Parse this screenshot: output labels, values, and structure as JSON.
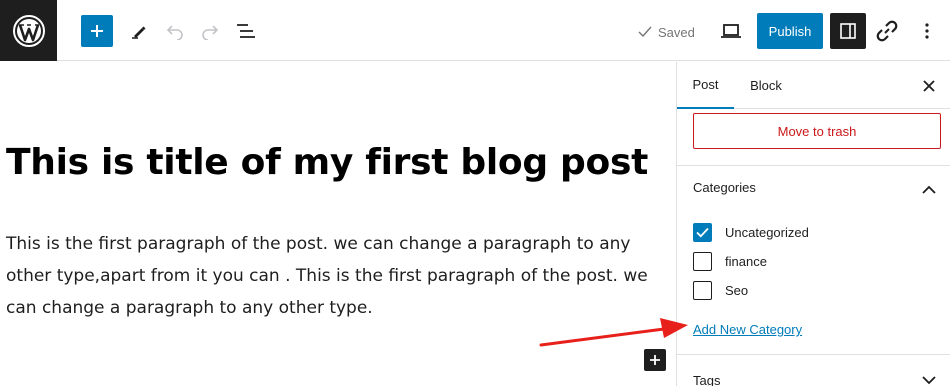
{
  "topbar": {
    "saved_label": "Saved",
    "publish_label": "Publish"
  },
  "editor": {
    "title": "This is title of my first blog post",
    "paragraph": "This is the first paragraph of the post. we can change a paragraph to any other type,apart from it you can  . This is the first paragraph of the post. we can change a paragraph to any other type."
  },
  "sidebar": {
    "tabs": [
      {
        "label": "Post",
        "active": true
      },
      {
        "label": "Block",
        "active": false
      }
    ],
    "trash_label": "Move to trash",
    "categories": {
      "header": "Categories",
      "items": [
        {
          "label": "Uncategorized",
          "checked": true
        },
        {
          "label": "finance",
          "checked": false
        },
        {
          "label": "Seo",
          "checked": false
        }
      ],
      "add_new_label": "Add New Category"
    },
    "tags_header": "Tags"
  },
  "colors": {
    "accent": "#007cba",
    "danger": "#cc1818",
    "annotation_arrow": "#e8201c",
    "dark": "#1e1e1e"
  },
  "icons": [
    "wordpress-logo-icon",
    "plus-icon",
    "pen-icon",
    "undo-icon",
    "redo-icon",
    "list-view-icon",
    "check-icon",
    "desktop-preview-icon",
    "sidebar-toggle-icon",
    "link-icon",
    "more-vertical-icon",
    "close-icon",
    "chevron-up-icon",
    "chevron-down-icon"
  ]
}
